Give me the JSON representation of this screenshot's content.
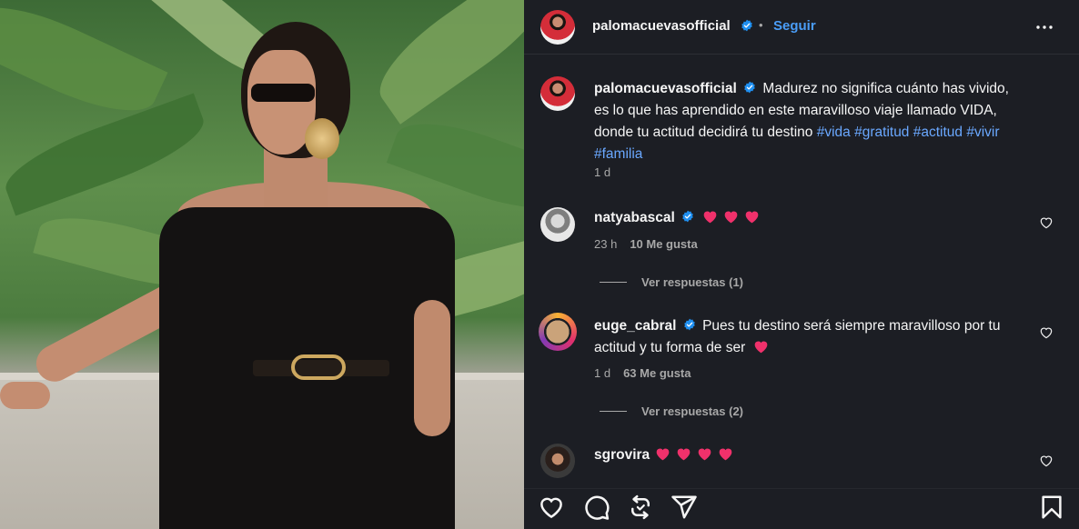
{
  "post": {
    "author": "palomacuevasofficial",
    "follow_label": "Seguir",
    "separator": "•",
    "more_icon": "more-horizontal-icon"
  },
  "caption": {
    "username": "palomacuevasofficial",
    "text": "Madurez no significa cuánto has vivido, es lo que has aprendido en este maravilloso viaje llamado VIDA, donde tu actitud decidirá tu destino",
    "hashtags": [
      "#vida",
      "#gratitud",
      "#actitud",
      "#vivir",
      "#familia"
    ],
    "time": "1 d"
  },
  "comments": [
    {
      "username": "natyabascal",
      "verified": true,
      "text": "",
      "emoji_count": 3,
      "time": "23 h",
      "likes": "10 Me gusta",
      "replies": "Ver respuestas (1)"
    },
    {
      "username": "euge_cabral",
      "verified": true,
      "text": "Pues tu destino será siempre maravilloso por tu actitud y tu forma de ser",
      "emoji_count": 1,
      "time": "1 d",
      "likes": "63 Me gusta",
      "replies": "Ver respuestas (2)"
    },
    {
      "username": "sgrovira",
      "verified": false,
      "text": "",
      "emoji_count": 4
    }
  ],
  "actions": [
    "heart-icon",
    "comment-icon",
    "repost-icon",
    "share-icon",
    "bookmark-icon"
  ],
  "colors": {
    "panel_bg": "#1c1e24",
    "link_blue": "#4a9df8",
    "hashtag_blue": "#6aa8ff",
    "muted": "#a8a8a8",
    "heart_pink": "#f0316b",
    "verified_blue": "#1f8ff0"
  }
}
